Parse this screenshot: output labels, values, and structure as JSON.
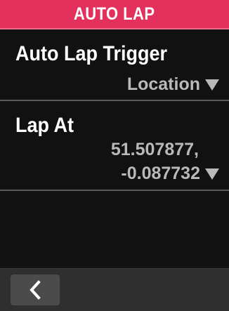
{
  "header": {
    "title": "AUTO LAP"
  },
  "settings": [
    {
      "label": "Auto Lap Trigger",
      "value": "Location",
      "dropdown_icon": "triangle-down-icon"
    },
    {
      "label": "Lap At",
      "value_line_1": "51.507877,",
      "value_line_2": "-0.087732",
      "dropdown_icon": "triangle-down-icon"
    }
  ],
  "footer": {
    "back_icon": "chevron-left-icon"
  },
  "colors": {
    "header": "#e2315d",
    "background": "#111111",
    "value_text": "#b9b9b9",
    "footer": "#2f2f2f",
    "button": "#4b4b4b"
  }
}
